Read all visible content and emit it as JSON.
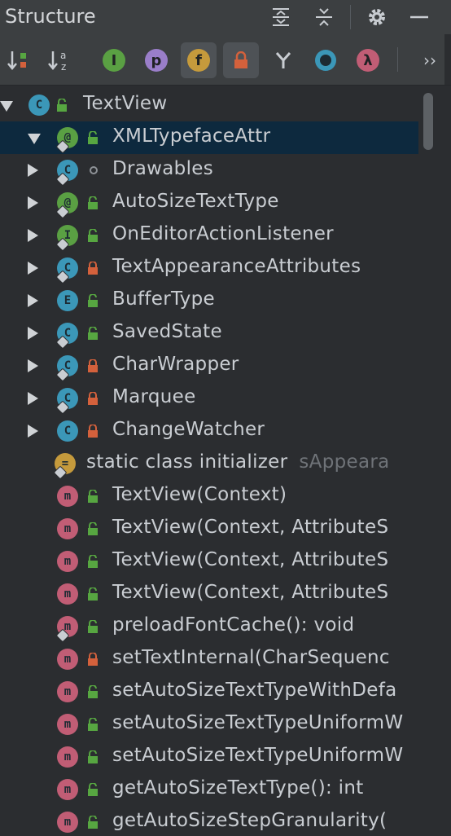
{
  "panel": {
    "title": "Structure"
  },
  "titlebar_icons": [
    "expand-all-icon",
    "collapse-all-icon",
    "gear-icon",
    "minimize-icon"
  ],
  "toolbar": {
    "buttons": [
      {
        "name": "sort-by-visibility-icon",
        "active": false
      },
      {
        "name": "sort-alphabetically-icon",
        "active": false
      },
      {
        "name": "show-inherited-icon",
        "active": false,
        "glyph": "I"
      },
      {
        "name": "show-properties-icon",
        "active": false,
        "glyph": "p"
      },
      {
        "name": "show-fields-icon",
        "active": true,
        "glyph": "f"
      },
      {
        "name": "show-non-public-icon",
        "active": true
      },
      {
        "name": "show-anonymous-icon",
        "active": false
      },
      {
        "name": "show-members-icon",
        "active": false
      },
      {
        "name": "show-lambdas-icon",
        "active": false,
        "glyph": "λ"
      }
    ],
    "more": "››"
  },
  "colors": {
    "class": "#3b97b8",
    "annotation": "#5aa043",
    "interface": "#5aa043",
    "enum": "#3b97b8",
    "method": "#c15d75",
    "initializer": "#c59a3c",
    "public": "#57a641",
    "private": "#d4613c",
    "selected_row": "#0d293e"
  },
  "tree": {
    "root": {
      "kind": "C",
      "label": "TextView",
      "visibility": "public",
      "expanded": true
    },
    "rows": [
      {
        "arrow": "down",
        "kind": "@",
        "label": "XMLTypefaceAttr",
        "visibility": "public",
        "selected": true,
        "badge": true
      },
      {
        "arrow": "right",
        "kind": "C",
        "label": "Drawables",
        "visibility": "package",
        "badge": true
      },
      {
        "arrow": "right",
        "kind": "@",
        "label": "AutoSizeTextType",
        "visibility": "public",
        "badge": true
      },
      {
        "arrow": "right",
        "kind": "I",
        "label": "OnEditorActionListener",
        "visibility": "public",
        "badge": true
      },
      {
        "arrow": "right",
        "kind": "C",
        "label": "TextAppearanceAttributes",
        "visibility": "private",
        "badge": true
      },
      {
        "arrow": "right",
        "kind": "E",
        "label": "BufferType",
        "visibility": "public",
        "badge": false
      },
      {
        "arrow": "right",
        "kind": "C",
        "label": "SavedState",
        "visibility": "public",
        "badge": true
      },
      {
        "arrow": "right",
        "kind": "C",
        "label": "CharWrapper",
        "visibility": "private",
        "badge": true
      },
      {
        "arrow": "right",
        "kind": "C",
        "label": "Marquee",
        "visibility": "private",
        "badge": true
      },
      {
        "arrow": "right",
        "kind": "C",
        "label": "ChangeWatcher",
        "visibility": "private",
        "badge": false
      },
      {
        "arrow": "none",
        "kind": "=",
        "label": "static class initializer",
        "hint": "sAppeara",
        "visibility": "none",
        "badge": true,
        "outdent": true
      },
      {
        "arrow": "none",
        "kind": "m",
        "label": "TextView(Context)",
        "visibility": "public",
        "badge": false
      },
      {
        "arrow": "none",
        "kind": "m",
        "label": "TextView(Context, AttributeS",
        "visibility": "public",
        "badge": false
      },
      {
        "arrow": "none",
        "kind": "m",
        "label": "TextView(Context, AttributeS",
        "visibility": "public",
        "badge": false
      },
      {
        "arrow": "none",
        "kind": "m",
        "label": "TextView(Context, AttributeS",
        "visibility": "public",
        "badge": false
      },
      {
        "arrow": "none",
        "kind": "m",
        "label": "preloadFontCache(): void",
        "visibility": "public",
        "badge": true
      },
      {
        "arrow": "none",
        "kind": "m",
        "label": "setTextInternal(CharSequenc",
        "visibility": "private",
        "badge": false
      },
      {
        "arrow": "none",
        "kind": "m",
        "label": "setAutoSizeTextTypeWithDefa",
        "visibility": "public",
        "badge": false
      },
      {
        "arrow": "none",
        "kind": "m",
        "label": "setAutoSizeTextTypeUniformW",
        "visibility": "public",
        "badge": false
      },
      {
        "arrow": "none",
        "kind": "m",
        "label": "setAutoSizeTextTypeUniformW",
        "visibility": "public",
        "badge": false
      },
      {
        "arrow": "none",
        "kind": "m",
        "label": "getAutoSizeTextType(): int",
        "visibility": "public",
        "badge": false
      },
      {
        "arrow": "none",
        "kind": "m",
        "label": "getAutoSizeStepGranularity(",
        "visibility": "public",
        "badge": false
      }
    ]
  }
}
